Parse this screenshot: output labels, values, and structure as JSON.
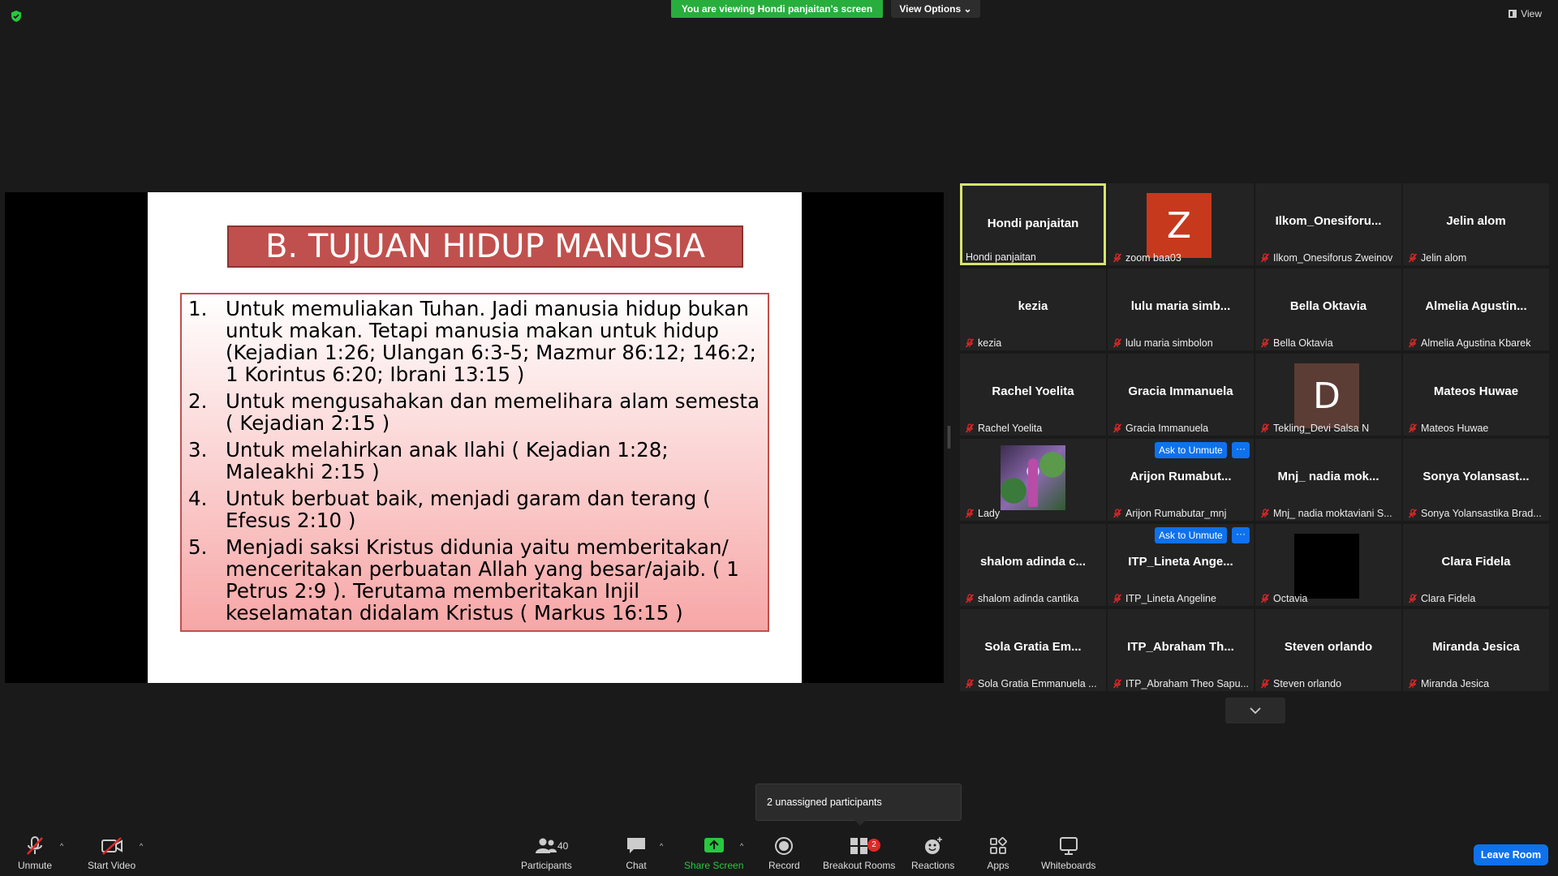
{
  "top": {
    "banner": "You are viewing Hondi panjaitan's screen",
    "view_options": "View Options",
    "view": "View"
  },
  "slide": {
    "title": "B. TUJUAN HIDUP MANUSIA",
    "items": [
      {
        "num": "1.",
        "text": "Untuk memuliakan Tuhan. Jadi manusia hidup bukan untuk makan. Tetapi manusia makan untuk hidup (Kejadian 1:26; Ulangan 6:3-5; Mazmur 86:12; 146:2;  1 Korintus 6:20; Ibrani 13:15 )"
      },
      {
        "num": "2.",
        "text": "Untuk mengusahakan dan memelihara alam semesta ( Kejadian 2:15 )"
      },
      {
        "num": "3.",
        "text": "Untuk melahirkan anak Ilahi ( Kejadian 1:28; Maleakhi 2:15 )"
      },
      {
        "num": "4.",
        "text": "Untuk berbuat baik, menjadi garam dan terang  ( Efesus 2:10 )"
      },
      {
        "num": "5.",
        "text": "Menjadi saksi Kristus didunia yaitu memberitakan/ menceritakan perbuatan Allah yang besar/ajaib. ( 1 Petrus 2:9 ).  Terutama memberitakan Injil keselamatan didalam Kristus ( Markus 16:15 )"
      }
    ]
  },
  "tiles": [
    {
      "big": "Hondi panjaitan",
      "small": "Hondi panjaitan",
      "active": true,
      "muted": false
    },
    {
      "big": "",
      "small": "zoom baa03",
      "avatar": "Z",
      "avatar_color": "#c7391c",
      "muted": true
    },
    {
      "big": "Ilkom_Onesiforu...",
      "small": "Ilkom_Onesiforus Zweinov",
      "muted": true
    },
    {
      "big": "Jelin alom",
      "small": "Jelin alom",
      "muted": true
    },
    {
      "big": "kezia",
      "small": "kezia",
      "muted": true
    },
    {
      "big": "lulu maria simb...",
      "small": "lulu maria simbolon",
      "muted": true
    },
    {
      "big": "Bella Oktavia",
      "small": "Bella Oktavia",
      "muted": true
    },
    {
      "big": "Almelia Agustin...",
      "small": "Almelia Agustina Kbarek",
      "muted": true
    },
    {
      "big": "Rachel Yoelita",
      "small": "Rachel Yoelita",
      "muted": true
    },
    {
      "big": "Gracia Immanuela",
      "small": "Gracia Immanuela",
      "muted": true
    },
    {
      "big": "",
      "small": "Tekling_Devi Salsa N",
      "avatar": "D",
      "avatar_color": "#5b3d35",
      "muted": true
    },
    {
      "big": "Mateos Huwae",
      "small": "Mateos Huwae",
      "muted": true
    },
    {
      "big": "",
      "small": "Lady",
      "photo": true,
      "muted": true
    },
    {
      "big": "Arijon Rumabut...",
      "small": "Arijon Rumabutar_mnj",
      "ask": true,
      "muted": true
    },
    {
      "big": "Mnj_ nadia mok...",
      "small": "Mnj_ nadia moktaviani S...",
      "muted": true
    },
    {
      "big": "Sonya Yolansast...",
      "small": "Sonya Yolansastika Brad...",
      "muted": true
    },
    {
      "big": "shalom adinda c...",
      "small": "shalom adinda cantika",
      "muted": true
    },
    {
      "big": "ITP_Lineta Ange...",
      "small": "ITP_Lineta Angeline",
      "ask": true,
      "muted": true
    },
    {
      "big": "",
      "small": "Octavia",
      "avatar": "",
      "avatar_color": "#000000",
      "muted": true
    },
    {
      "big": "Clara Fidela",
      "small": "Clara Fidela",
      "muted": true
    },
    {
      "big": "Sola Gratia Em...",
      "small": "Sola Gratia Emmanuela ...",
      "muted": true
    },
    {
      "big": "ITP_Abraham Th...",
      "small": "ITP_Abraham Theo Sapu...",
      "muted": true
    },
    {
      "big": "Steven orlando",
      "small": "Steven orlando",
      "muted": true
    },
    {
      "big": "Miranda Jesica",
      "small": "Miranda Jesica",
      "muted": true
    }
  ],
  "ask_to_unmute": "Ask to Unmute",
  "ask_more": "···",
  "tooltip": "2 unassigned participants",
  "toolbar": {
    "unmute": "Unmute",
    "start_video": "Start Video",
    "participants": "Participants",
    "participants_count": "40",
    "chat": "Chat",
    "share_screen": "Share Screen",
    "record": "Record",
    "breakout_rooms": "Breakout Rooms",
    "breakout_badge": "2",
    "reactions": "Reactions",
    "apps": "Apps",
    "whiteboards": "Whiteboards",
    "leave_room": "Leave Room"
  },
  "colors": {
    "green": "#27ae3c",
    "blue": "#0e72ed",
    "active_border": "#d7e46c",
    "slide_red": "#c0504d"
  }
}
